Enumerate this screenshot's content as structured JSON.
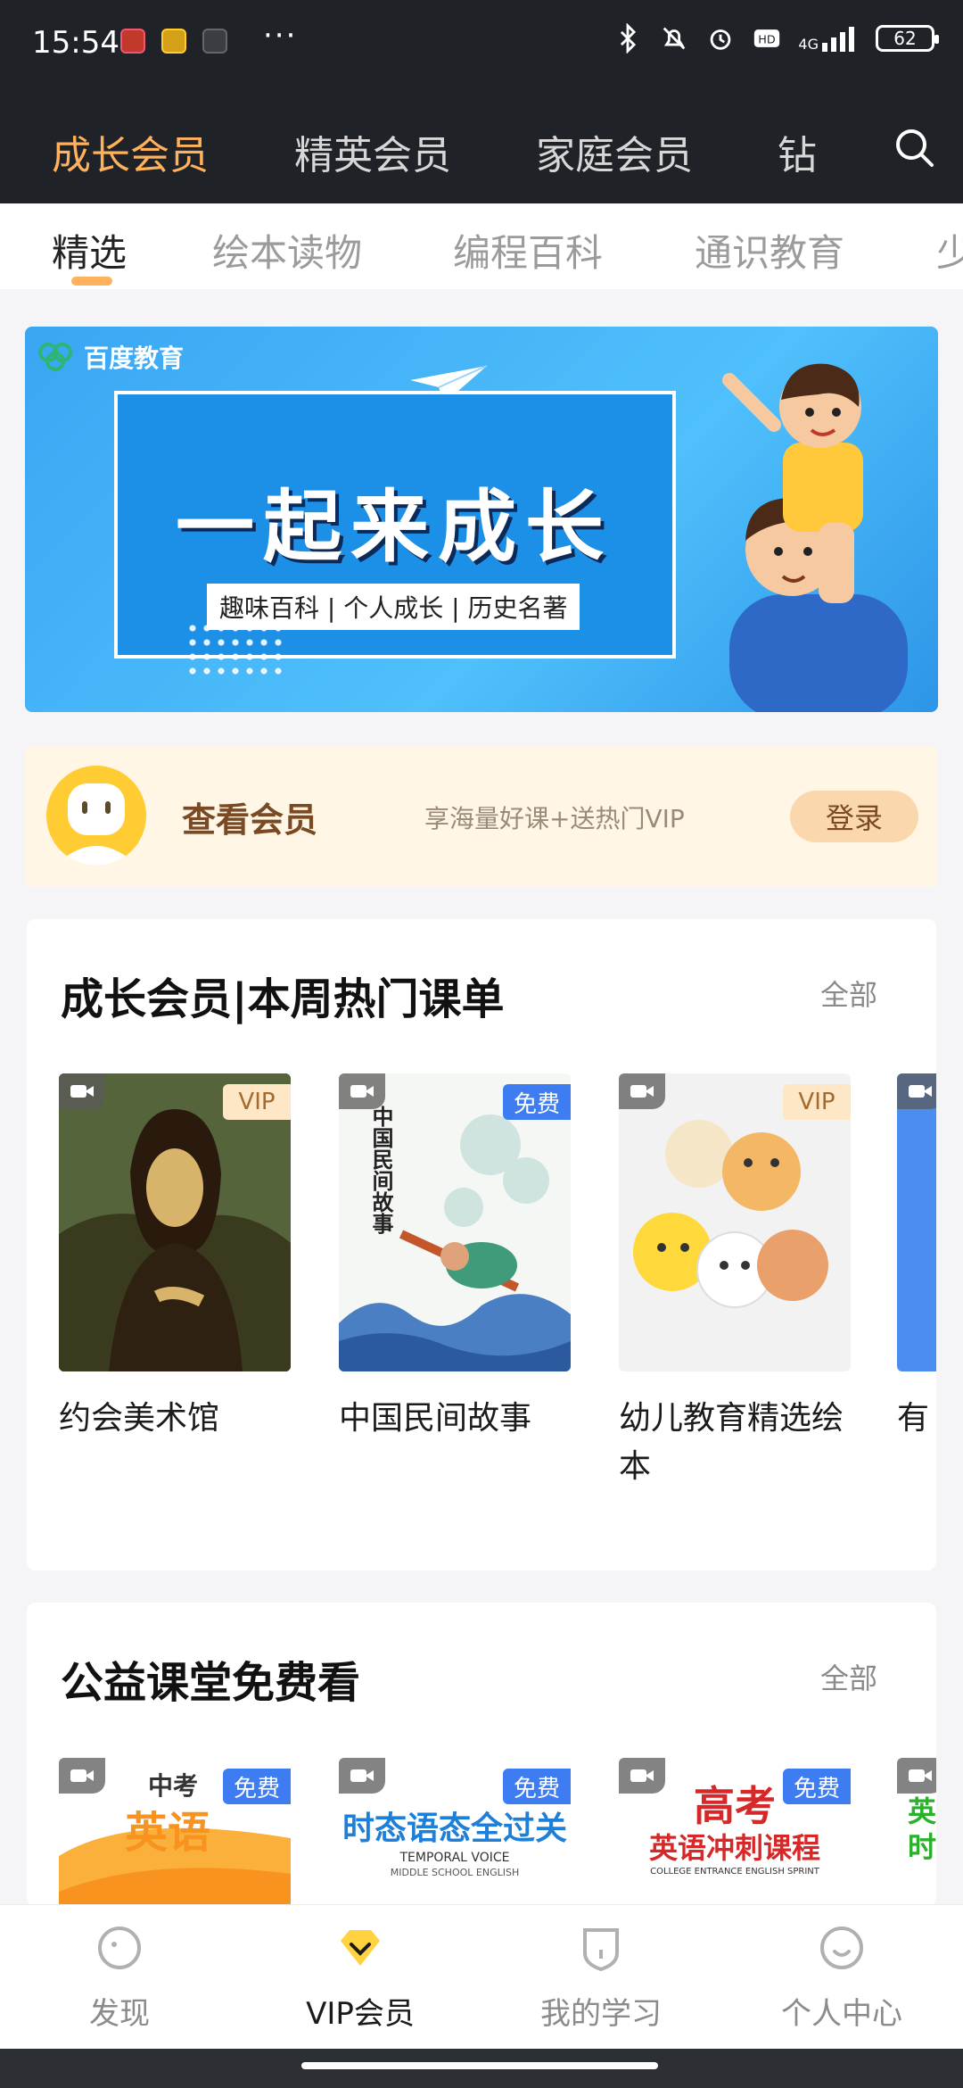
{
  "status": {
    "time": "15:54",
    "dots": "···",
    "network": "4G",
    "battery": "62"
  },
  "member_tabs": [
    "成长会员",
    "精英会员",
    "家庭会员",
    "钻"
  ],
  "category_tabs": [
    "精选",
    "绘本读物",
    "编程百科",
    "通识教育",
    "少"
  ],
  "banner": {
    "logo_text": "百度教育",
    "title": "一起来成长",
    "tags": "趣味百科 | 个人成长 | 历史名著"
  },
  "member_card": {
    "title": "查看会员",
    "subtitle": "享海量好课+送热门VIP",
    "login": "登录"
  },
  "section_hot": {
    "title": "成长会员|本周热门课单",
    "all": "全部",
    "items": [
      {
        "title": "约会美术馆",
        "badge": "VIP",
        "badge_type": "vip",
        "thumb_text": ""
      },
      {
        "title": "中国民间故事",
        "badge": "免费",
        "badge_type": "free",
        "thumb_text": "中国民间故事"
      },
      {
        "title": "幼儿教育精选绘本",
        "badge": "VIP",
        "badge_type": "vip",
        "thumb_text": ""
      },
      {
        "title": "有",
        "badge": "",
        "badge_type": "",
        "thumb_text": ""
      }
    ]
  },
  "section_free": {
    "title": "公益课堂免费看",
    "all": "全部",
    "items": [
      {
        "badge": "免费",
        "thumb_top": "中考",
        "thumb_main": "英语",
        "thumb_sub": ""
      },
      {
        "badge": "免费",
        "thumb_top": "",
        "thumb_main": "时态语态全过关",
        "thumb_sub": "TEMPORAL VOICE"
      },
      {
        "badge": "免费",
        "thumb_top": "高考",
        "thumb_main": "英语冲刺课程",
        "thumb_sub": "COLLEGE ENTRANCE ENGLISH SPRINT"
      },
      {
        "badge": "",
        "thumb_top": "",
        "thumb_main": "英时",
        "thumb_sub": ""
      }
    ],
    "free_item_2_sub2": "MIDDLE SCHOOL ENGLISH"
  },
  "bottom_nav": [
    "发现",
    "VIP会员",
    "我的学习",
    "个人中心"
  ],
  "colors": {
    "accent": "#ffb15c",
    "dark_header": "#1f2227",
    "free_badge": "#3e7cf2",
    "vip_badge_bg": "#fde7c6"
  }
}
